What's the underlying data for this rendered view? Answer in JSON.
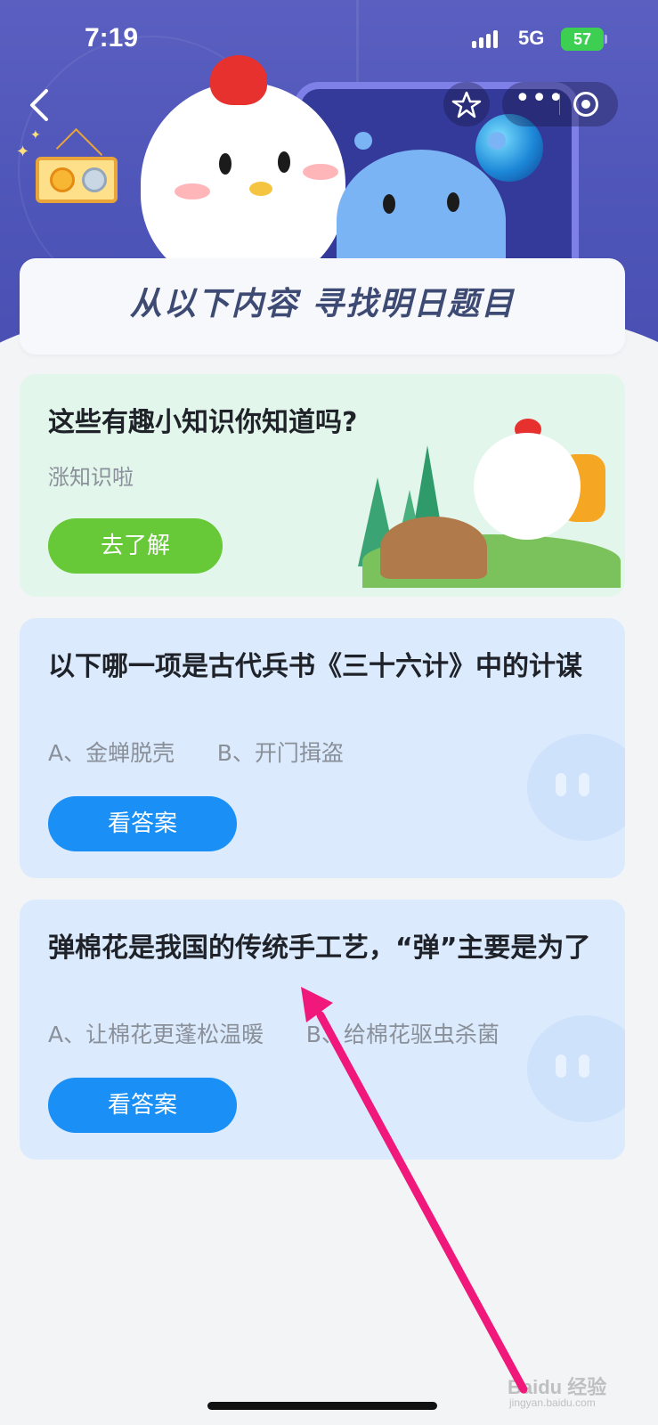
{
  "status_bar": {
    "time": "7:19",
    "network": "5G",
    "battery": "57"
  },
  "header": {
    "title": "从以下内容 寻找明日题目"
  },
  "intro_card": {
    "title": "这些有趣小知识你知道吗?",
    "subtitle": "涨知识啦",
    "button": "去了解"
  },
  "questions": [
    {
      "title": "以下哪一项是古代兵书《三十六计》中的计谋",
      "options": "A、金蝉脱壳      B、开门揖盗",
      "button": "看答案"
    },
    {
      "title": "弹棉花是我国的传统手工艺，“弹”主要是为了",
      "options": "A、让棉花更蓬松温暖      B、给棉花驱虫杀菌",
      "button": "看答案"
    }
  ],
  "watermark": {
    "brand": "Baidu 经验",
    "url": "jingyan.baidu.com"
  },
  "colors": {
    "hero": "#4e55b8",
    "green_button": "#67c937",
    "blue_button": "#1a8ff5",
    "arrow": "#f0187a"
  }
}
